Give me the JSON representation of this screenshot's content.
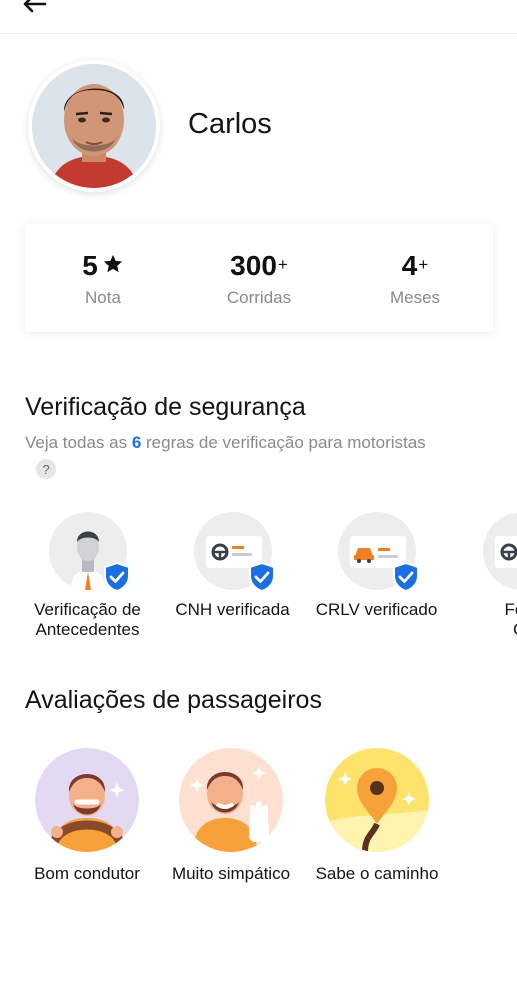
{
  "topbar": {
    "back_icon": "arrow-left-icon"
  },
  "profile": {
    "name": "Carlos"
  },
  "stats": [
    {
      "value": "5",
      "suffix": "",
      "icon": "star-icon",
      "label": "Nota"
    },
    {
      "value": "300",
      "suffix": "+",
      "label": "Corridas"
    },
    {
      "value": "4",
      "suffix": "+",
      "label": "Meses"
    }
  ],
  "security": {
    "title": "Verificação de segurança",
    "subtitle_prefix": "Veja todas as ",
    "subtitle_count": "6",
    "subtitle_suffix": " regras de verificação para motoristas",
    "help": "?",
    "items": [
      {
        "label": "Verificação de\nAntecedentes",
        "icon": "background-check-icon"
      },
      {
        "label": "CNH verificada",
        "icon": "license-icon"
      },
      {
        "label": "CRLV verificado",
        "icon": "vehicle-document-icon"
      },
      {
        "label": "Foto\nCI",
        "icon": "photo-id-icon"
      }
    ]
  },
  "reviews": {
    "title": "Avaliações de passageiros",
    "items": [
      {
        "label": "Bom condutor",
        "icon": "good-driver-icon"
      },
      {
        "label": "Muito simpático",
        "icon": "friendly-icon"
      },
      {
        "label": "Sabe o caminho",
        "icon": "knows-the-way-icon"
      }
    ]
  },
  "colors": {
    "accent": "#1b6fe0",
    "secondary_text": "#8a8a8a",
    "badge_blue": "#1b6fe0",
    "orange": "#f7a13a"
  }
}
